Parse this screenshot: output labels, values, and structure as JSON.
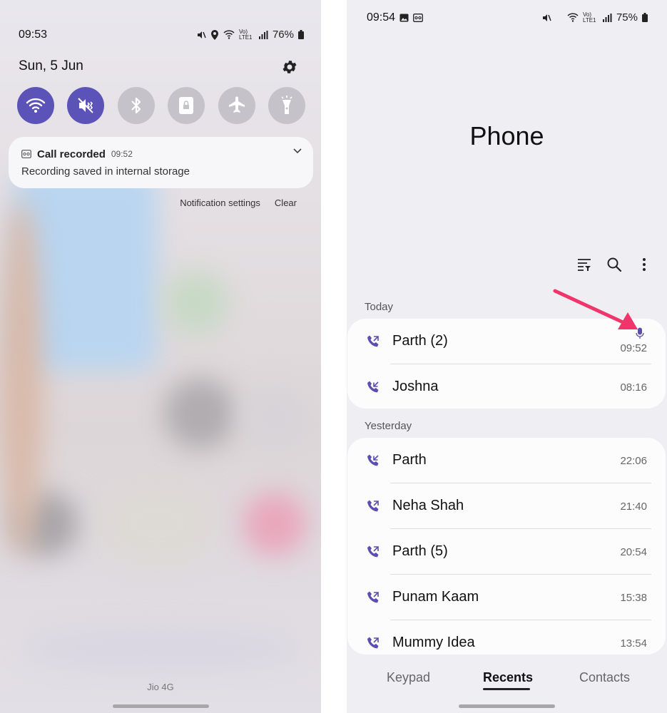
{
  "left": {
    "status": {
      "time": "09:53",
      "battery": "76%",
      "network": "Vo) LTE1"
    },
    "date": "Sun, 5 Jun",
    "quick_settings": [
      {
        "icon": "wifi-icon",
        "state": "on"
      },
      {
        "icon": "mute-icon",
        "state": "on"
      },
      {
        "icon": "bluetooth-icon",
        "state": "off"
      },
      {
        "icon": "screen-lock-icon",
        "state": "off"
      },
      {
        "icon": "airplane-icon",
        "state": "off"
      },
      {
        "icon": "flashlight-icon",
        "state": "off"
      }
    ],
    "notification": {
      "title": "Call recorded",
      "time": "09:52",
      "body": "Recording saved in internal storage"
    },
    "actions": {
      "settings": "Notification settings",
      "clear": "Clear"
    },
    "carrier": "Jio 4G"
  },
  "right": {
    "status": {
      "time": "09:54",
      "battery": "75%",
      "network": "Vo) LTE1"
    },
    "title": "Phone",
    "sections": [
      {
        "label": "Today",
        "calls": [
          {
            "name": "Parth (2)",
            "time": "09:52",
            "type": "outgoing",
            "recorded": true
          },
          {
            "name": "Joshna",
            "time": "08:16",
            "type": "incoming",
            "recorded": false
          }
        ]
      },
      {
        "label": "Yesterday",
        "calls": [
          {
            "name": "Parth",
            "time": "22:06",
            "type": "incoming",
            "recorded": false
          },
          {
            "name": "Neha Shah",
            "time": "21:40",
            "type": "outgoing",
            "recorded": false
          },
          {
            "name": "Parth (5)",
            "time": "20:54",
            "type": "outgoing",
            "recorded": false
          },
          {
            "name": "Punam Kaam",
            "time": "15:38",
            "type": "outgoing",
            "recorded": false
          },
          {
            "name": "Mummy Idea",
            "time": "13:54",
            "type": "outgoing",
            "recorded": false
          }
        ]
      }
    ],
    "tabs": [
      {
        "label": "Keypad",
        "active": false
      },
      {
        "label": "Recents",
        "active": true
      },
      {
        "label": "Contacts",
        "active": false
      }
    ]
  },
  "colors": {
    "accent": "#5c53b8",
    "tile_off": "#c5c3c9",
    "arrow": "#f0356b",
    "call_icon": "#5a4fb0"
  }
}
